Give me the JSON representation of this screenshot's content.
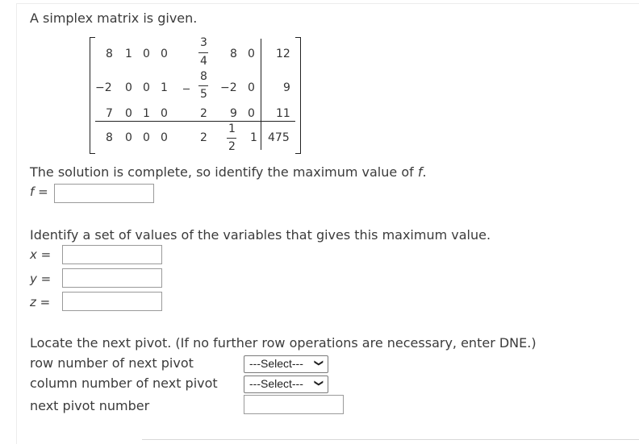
{
  "intro": "A simplex matrix is given.",
  "matrix": {
    "r1": {
      "a": "8",
      "b": "1",
      "c": "0",
      "d": "0",
      "f_num": "3",
      "f_den": "4",
      "g": "8",
      "h": "0",
      "rhs": "12"
    },
    "r2": {
      "a": "−2",
      "b": "0",
      "c": "0",
      "d": "1",
      "f_num": "8",
      "f_den": "5",
      "g": "−2",
      "h": "0",
      "rhs": "9"
    },
    "r3": {
      "a": "7",
      "b": "0",
      "c": "1",
      "d": "0",
      "f": "2",
      "g": "9",
      "h": "0",
      "rhs": "11"
    },
    "r4": {
      "a": "8",
      "b": "0",
      "c": "0",
      "d": "0",
      "f": "2",
      "g_num": "1",
      "g_den": "2",
      "h": "1",
      "rhs": "475"
    }
  },
  "q1": {
    "text": "The solution is complete, so identify the maximum value of ",
    "var": "f",
    "dot": ".",
    "label_f": "f",
    "eq": "="
  },
  "q2": {
    "text": "Identify a set of values of the variables that gives this maximum value.",
    "x": "x",
    "y": "y",
    "z": "z",
    "eq": "="
  },
  "q3": {
    "text": "Locate the next pivot. (If no further row operations are necessary, enter DNE.)",
    "row_label": "row number of next pivot",
    "col_label": "column number of next pivot",
    "num_label": "next pivot number",
    "row_select": "---Select---",
    "col_select": "---Select---"
  }
}
